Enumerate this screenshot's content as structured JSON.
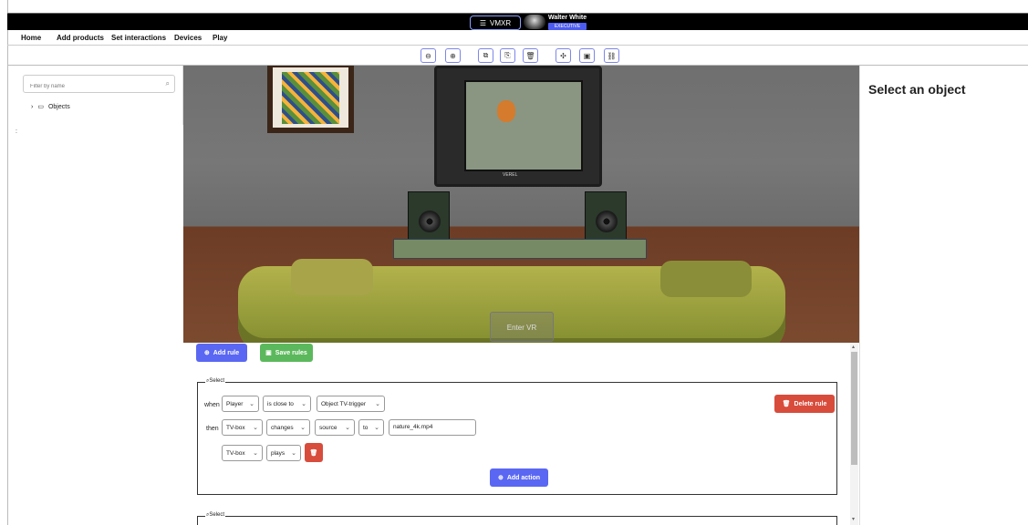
{
  "header": {
    "brand_label": "VMXR",
    "user_name": "Walter White",
    "user_role": "EXECUTIVE"
  },
  "menu": [
    "Home",
    "Add products",
    "Set interactions",
    "Devices",
    "Play"
  ],
  "toolbar": {
    "icons": [
      "arrow-left-circle-icon",
      "arrow-right-circle-icon",
      "copy-icon",
      "paste-icon",
      "trash-icon",
      "move-icon",
      "group-icon",
      "ungroup-icon"
    ]
  },
  "sidebar": {
    "filter_placeholder": "Filter by name",
    "tree_label": "Objects",
    "colon": ":"
  },
  "scene": {
    "tv_brand": "VEREL",
    "enter_vr": "Enter VR"
  },
  "right_panel": {
    "title": "Select an object"
  },
  "rules_panel": {
    "add_rule": "Add rule",
    "save_rules": "Save rules",
    "rule_legend": "Select",
    "when_label": "when",
    "then_label": "then",
    "to_label": "to",
    "when_subject": "Player",
    "condition": "is close to",
    "trigger_object": "Object TV-trigger",
    "action1_subject": "TV-box",
    "action1_verb": "changes",
    "action1_property": "source",
    "action1_to_select": "to",
    "action1_value": "nature_4k.mp4",
    "action2_subject": "TV-box",
    "action2_verb": "plays",
    "delete_rule": "Delete rule",
    "add_action": "Add action",
    "rule2_legend": "Select"
  }
}
